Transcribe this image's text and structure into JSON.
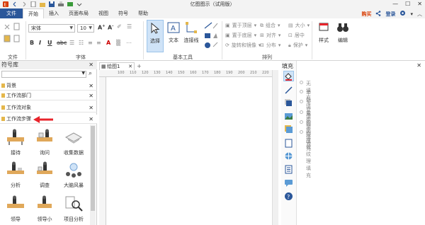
{
  "app": {
    "title": "亿图图示（试用版）",
    "window_buttons": [
      "—",
      "☐",
      "✕"
    ]
  },
  "menu": {
    "file": "文件",
    "tabs": [
      "开始",
      "插入",
      "页面布局",
      "视图",
      "符号",
      "帮助"
    ],
    "active_tab": "开始",
    "buy": "购买",
    "login": "登录"
  },
  "ribbon": {
    "font_name": "宋体",
    "font_size": "10",
    "groups": {
      "file": "文件",
      "font": "字体",
      "basic_tools": "基本工具",
      "arrange": "排列",
      "style_label": "样式",
      "edit_label": "编辑"
    },
    "tools": {
      "select": "选择",
      "text": "文本",
      "connector": "连接线"
    },
    "arrange_items": {
      "bring_front": "置于顶层",
      "send_back": "置于底层",
      "rotate_flip": "旋转和镜像",
      "group": "组合",
      "align": "对齐",
      "distribute": "分布",
      "size": "大小",
      "center": "居中",
      "protect": "保护"
    }
  },
  "library": {
    "title": "符号库",
    "search_placeholder": "",
    "items": [
      "背景",
      "工作流部门",
      "工作流对象",
      "工作流步骤"
    ],
    "selected": "工作流步骤",
    "shapes": [
      "接待",
      "询问",
      "收集数据",
      "分析",
      "调查",
      "大脑风暴",
      "领导",
      "领导小",
      "项目分析"
    ]
  },
  "document": {
    "tab": "绘图1",
    "ruler_ticks": [
      "100",
      "110",
      "120",
      "130",
      "140",
      "150",
      "160",
      "170",
      "180",
      "190",
      "200",
      "210",
      "220",
      "230",
      "240"
    ]
  },
  "fill_panel": {
    "title": "填充",
    "options": [
      "无填充",
      "单色填充",
      "渐变填充",
      "单色渐变填充",
      "图案填充",
      "图片或纹理填充"
    ]
  },
  "colors": {
    "file_tab": "#2b579a",
    "accent_red": "#e8242b",
    "buy": "#d83b01"
  }
}
